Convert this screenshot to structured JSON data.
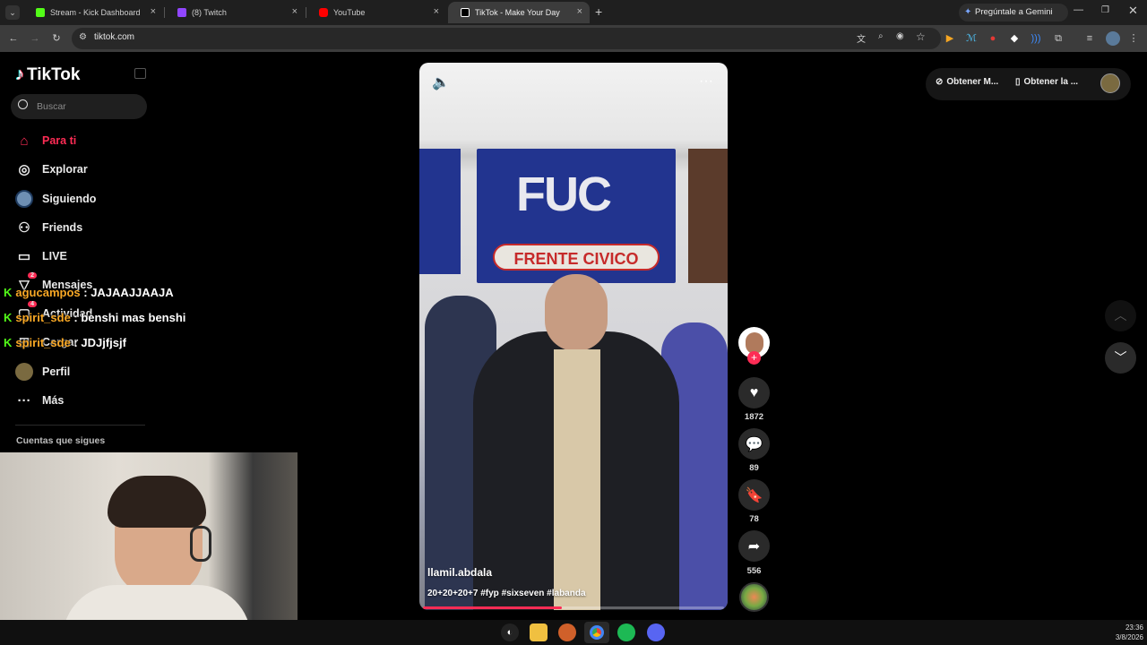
{
  "browser": {
    "tabs": [
      {
        "label": "Stream - Kick Dashboard",
        "icon": "kick-icon",
        "color": "#53fc18"
      },
      {
        "label": "(8) Twitch",
        "icon": "twitch-icon",
        "color": "#9146ff"
      },
      {
        "label": "YouTube",
        "icon": "youtube-icon",
        "color": "#ff0000"
      },
      {
        "label": "TikTok - Make Your Day",
        "icon": "tiktok-icon",
        "color": "#ffffff"
      }
    ],
    "url": "tiktok.com",
    "gemini_label": "Pregúntale a Gemini"
  },
  "sidebar": {
    "logo": "TikTok",
    "search_placeholder": "Buscar",
    "items": [
      {
        "label": "Para ti",
        "icon": "home-icon",
        "active": true
      },
      {
        "label": "Explorar",
        "icon": "compass-icon"
      },
      {
        "label": "Siguiendo",
        "icon": "following-avatar-icon"
      },
      {
        "label": "Friends",
        "icon": "friends-icon"
      },
      {
        "label": "LIVE",
        "icon": "live-icon"
      },
      {
        "label": "Mensajes",
        "icon": "messages-icon",
        "badge": "2"
      },
      {
        "label": "Actividad",
        "icon": "activity-icon",
        "badge": "4"
      },
      {
        "label": "Cargar",
        "icon": "upload-icon"
      },
      {
        "label": "Perfil",
        "icon": "profile-avatar-icon"
      },
      {
        "label": "Más",
        "icon": "more-icon"
      }
    ],
    "following_heading": "Cuentas que sigues"
  },
  "chat_overlay": [
    {
      "user": "agucampos",
      "message": " : JAJAAJJAAJA"
    },
    {
      "user": "spirit_sde",
      "message": " : benshi mas benshi"
    },
    {
      "user": "spirit_sde",
      "message": " : JDJjfjsjf"
    }
  ],
  "video": {
    "author": "llamil.abdala",
    "caption": "20+20+20+7 #fyp #sixseven #labanda",
    "banner_text": "FRENTE CIVICO",
    "banner_logo": "FUC",
    "progress": 0.46
  },
  "actions": {
    "likes": "1872",
    "comments": "89",
    "saves": "78",
    "shares": "556"
  },
  "header_right": {
    "btn1": "Obtener M...",
    "btn2": "Obtener la ..."
  },
  "clock": {
    "time": "23:36",
    "date": "3/8/2026"
  },
  "colors": {
    "accent": "#fe2c55",
    "chat_user": "#f9a825",
    "kick_green": "#53fc18"
  }
}
